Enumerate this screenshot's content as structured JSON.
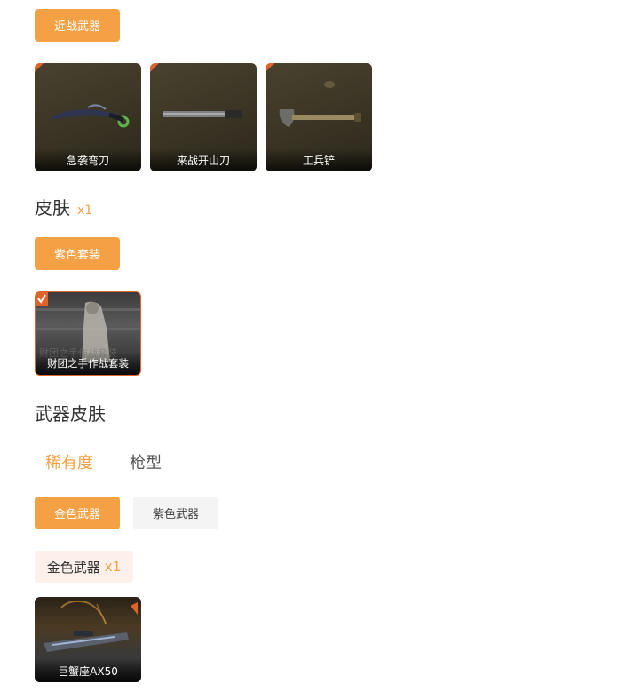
{
  "melee": {
    "filter_label": "近战武器",
    "items": [
      {
        "name": "急袭弯刀"
      },
      {
        "name": "来战开山刀"
      },
      {
        "name": "工兵铲"
      }
    ]
  },
  "skin": {
    "title": "皮肤",
    "count": "x1",
    "filter_label": "紫色套装",
    "items": [
      {
        "name": "财团之手作战套装",
        "bg_text": "财团之手作战套装"
      }
    ]
  },
  "weapon_skin": {
    "title": "武器皮肤",
    "tabs": [
      {
        "label": "稀有度",
        "active": true
      },
      {
        "label": "枪型",
        "active": false
      }
    ],
    "filters": [
      {
        "label": "金色武器",
        "active": true
      },
      {
        "label": "紫色武器",
        "active": false
      }
    ],
    "group": {
      "label": "金色武器",
      "count": "x1"
    },
    "items": [
      {
        "name": "巨蟹座AX50"
      }
    ]
  },
  "colors": {
    "accent": "#f4a145",
    "rarity_orange": "#e0632c"
  }
}
